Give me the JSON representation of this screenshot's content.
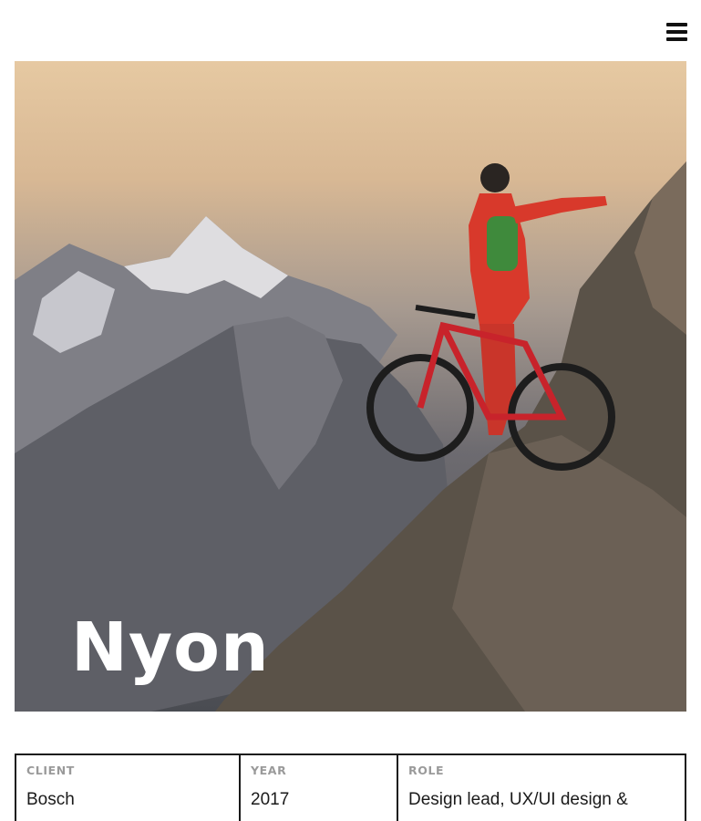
{
  "header": {
    "menu_icon": "hamburger-menu-icon"
  },
  "hero": {
    "title": "Nyon",
    "image_subject": "mountain-biker-on-rocky-ridge"
  },
  "details": {
    "client": {
      "label": "CLIENT",
      "value": "Bosch"
    },
    "year": {
      "label": "YEAR",
      "value": "2017"
    },
    "role": {
      "label": "ROLE",
      "value": "Design lead, UX/UI design &"
    }
  },
  "colors": {
    "text": "#1a1a1a",
    "label": "#9a9a9a",
    "border": "#1a1a1a",
    "title": "#ffffff"
  }
}
